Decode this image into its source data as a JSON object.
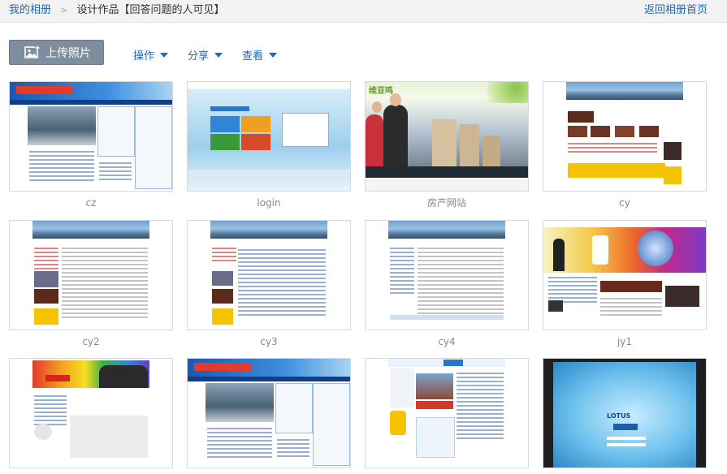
{
  "breadcrumb": {
    "home": "我的相册",
    "separator": ">",
    "current": "设计作品【回答问题的人可见】"
  },
  "back_link": "返回相册首页",
  "toolbar": {
    "upload_label": "上传照片",
    "menus": [
      "操作",
      "分享",
      "查看"
    ]
  },
  "photos": [
    {
      "caption": "cz",
      "icon": "website-screenshot"
    },
    {
      "caption": "login",
      "icon": "login-page-screenshot"
    },
    {
      "caption": "房产网站",
      "icon": "real-estate-site-screenshot"
    },
    {
      "caption": "cy",
      "icon": "website-screenshot"
    },
    {
      "caption": "cy2",
      "icon": "website-screenshot"
    },
    {
      "caption": "cy3",
      "icon": "website-screenshot"
    },
    {
      "caption": "cy4",
      "icon": "website-screenshot"
    },
    {
      "caption": "jy1",
      "icon": "website-screenshot"
    },
    {
      "caption": "",
      "icon": "website-screenshot"
    },
    {
      "caption": "",
      "icon": "website-screenshot"
    },
    {
      "caption": "",
      "icon": "website-screenshot"
    },
    {
      "caption": "",
      "icon": "tablet-login-screenshot"
    }
  ],
  "thumb_text": {
    "real_estate_brand": "维亚鸣",
    "lotus_brand": "LOTUS"
  },
  "colors": {
    "link": "#2168b5",
    "upload_button": "#7f8e9c",
    "topbar": "#f2f2f2"
  }
}
